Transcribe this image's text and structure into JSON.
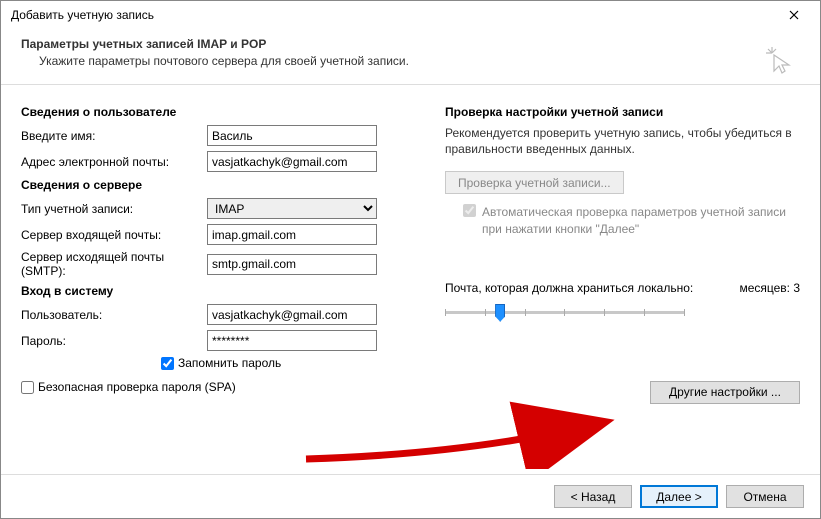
{
  "window": {
    "title": "Добавить учетную запись"
  },
  "header": {
    "title": "Параметры учетных записей IMAP и POP",
    "subtitle": "Укажите параметры почтового сервера для своей учетной записи."
  },
  "left": {
    "user_section": "Сведения о пользователе",
    "name_label": "Введите имя:",
    "name_value": "Василь",
    "email_label": "Адрес электронной почты:",
    "email_value": "vasjatkachyk@gmail.com",
    "server_section": "Сведения о сервере",
    "acct_type_label": "Тип учетной записи:",
    "acct_type_value": "IMAP",
    "incoming_label": "Сервер входящей почты:",
    "incoming_value": "imap.gmail.com",
    "outgoing_label": "Сервер исходящей почты (SMTP):",
    "outgoing_value": "smtp.gmail.com",
    "login_section": "Вход в систему",
    "user_label": "Пользователь:",
    "user_value": "vasjatkachyk@gmail.com",
    "pass_label": "Пароль:",
    "pass_value": "********",
    "remember_label": "Запомнить пароль",
    "spa_label": "Безопасная проверка пароля (SPA)"
  },
  "right": {
    "section": "Проверка настройки учетной записи",
    "desc": "Рекомендуется проверить учетную запись, чтобы убедиться в правильности введенных данных.",
    "test_btn": "Проверка учетной записи...",
    "auto_test": "Автоматическая проверка параметров учетной записи при нажатии кнопки \"Далее\"",
    "slider_label": "Почта, которая должна храниться локально:",
    "slider_value": "месяцев: 3",
    "more_btn": "Другие настройки ..."
  },
  "footer": {
    "back": "< Назад",
    "next": "Далее >",
    "cancel": "Отмена"
  }
}
